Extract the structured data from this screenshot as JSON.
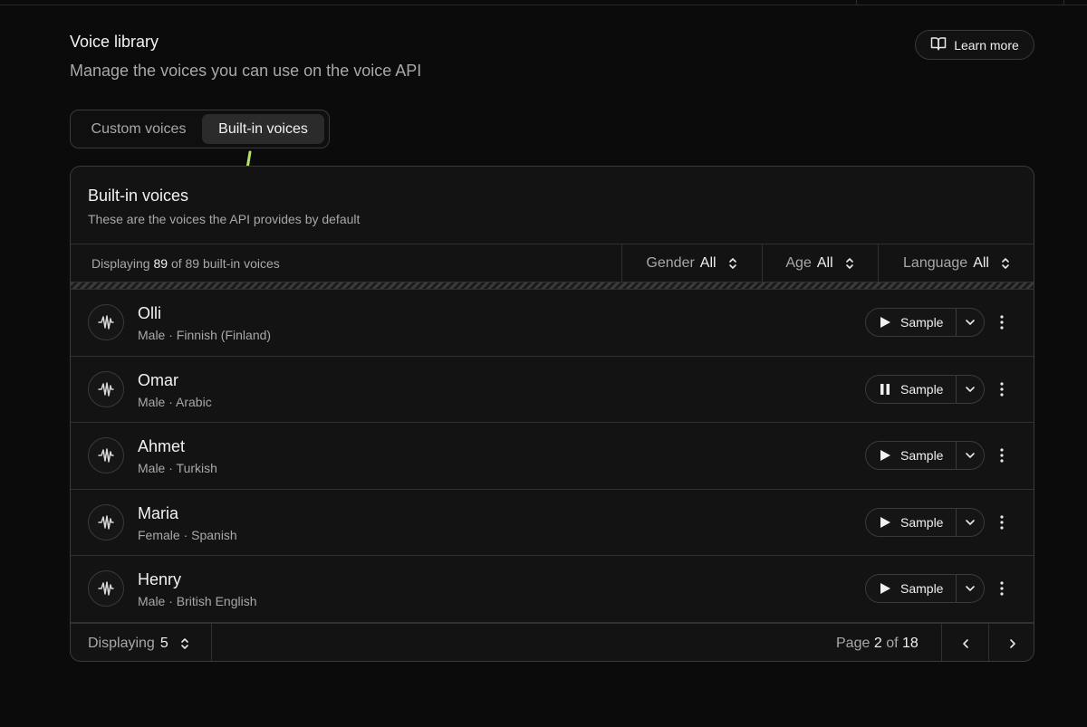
{
  "header": {
    "title": "Voice library",
    "subtitle": "Manage the voices you can use on the voice API",
    "learn_more_label": "Learn more"
  },
  "tabs": [
    {
      "label": "Custom voices",
      "active": false
    },
    {
      "label": "Built-in voices",
      "active": true
    }
  ],
  "card": {
    "title": "Built-in voices",
    "subtitle": "These are the voices the API provides by default"
  },
  "filterbar": {
    "count_prefix": "Displaying",
    "count_shown": "89",
    "count_suffix": "of 89 built-in voices",
    "filters": [
      {
        "label": "Gender",
        "value": "All"
      },
      {
        "label": "Age",
        "value": "All"
      },
      {
        "label": "Language",
        "value": "All"
      }
    ]
  },
  "voices": [
    {
      "name": "Olli",
      "meta": "Male · Finnish (Finland)",
      "sample_label": "Sample",
      "playing": false
    },
    {
      "name": "Omar",
      "meta": "Male · Arabic",
      "sample_label": "Sample",
      "playing": true
    },
    {
      "name": "Ahmet",
      "meta": "Male · Turkish",
      "sample_label": "Sample",
      "playing": false
    },
    {
      "name": "Maria",
      "meta": "Female · Spanish",
      "sample_label": "Sample",
      "playing": false
    },
    {
      "name": "Henry",
      "meta": "Male · British English",
      "sample_label": "Sample",
      "playing": false
    }
  ],
  "footer": {
    "display_label": "Displaying",
    "display_value": "5",
    "page_prefix": "Page",
    "page_current": "2",
    "page_of": "of",
    "page_total": "18"
  },
  "icons": {
    "learn_more": "book-open-icon",
    "avatar": "waveform-icon",
    "play": "play-icon",
    "pause": "pause-icon",
    "caret": "chevron-down-icon",
    "more": "more-vertical-icon",
    "sort": "chevron-up-down-icon",
    "prev": "chevron-left-icon",
    "next": "chevron-right-icon",
    "annotation": "annotation-arrow-icon"
  },
  "colors": {
    "background": "#0b0b0b",
    "card": "#131313",
    "border": "#3a3a3a",
    "annotation_arrow": "#b5e26a"
  }
}
